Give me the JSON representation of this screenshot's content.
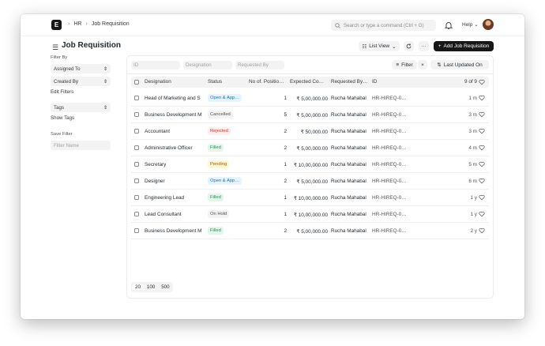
{
  "navbar": {
    "logo_letter": "E",
    "breadcrumbs": [
      "HR",
      "Job Requisition"
    ],
    "search_placeholder": "Search or type a command (Ctrl + G)",
    "help_label": "Help"
  },
  "page": {
    "title": "Job Requisition",
    "list_view_label": "List View",
    "more_label": "···",
    "add_label": "Add Job Requisition"
  },
  "sidebar": {
    "filter_by_label": "Filter By",
    "assigned_to": "Assigned To",
    "created_by": "Created By",
    "edit_filters": "Edit Filters",
    "tags": "Tags",
    "show_tags": "Show Tags",
    "save_filter_label": "Save Filter",
    "filter_name_placeholder": "Filter Name"
  },
  "filters": {
    "id_placeholder": "ID",
    "designation_placeholder": "Designation",
    "requested_by_placeholder": "Requested By",
    "filter_label": "Filter",
    "sort_label": "Last Updated On"
  },
  "table": {
    "columns": [
      "Designation",
      "Status",
      "No of. Positio…",
      "Expected Co…",
      "Requested By…",
      "ID"
    ],
    "count": "9 of 9",
    "rows": [
      {
        "designation": "Head of Marketing and S",
        "status": "Open & App…",
        "status_kind": "blue",
        "positions": "1",
        "compensation": "₹ 5,00,000.00",
        "requested_by": "Rucha Mahabal",
        "id": "HR-HIREQ-0…",
        "age": "1 m"
      },
      {
        "designation": "Business Development M",
        "status": "Cancelled",
        "status_kind": "gray",
        "positions": "5",
        "compensation": "₹ 5,00,000.00",
        "requested_by": "Rucha Mahabal",
        "id": "HR-HIREQ-0…",
        "age": "3 m"
      },
      {
        "designation": "Accountant",
        "status": "Rejected",
        "status_kind": "red",
        "positions": "2",
        "compensation": "₹ 50,000.00",
        "requested_by": "Rucha Mahabal",
        "id": "HR-HIREQ-0…",
        "age": "3 m"
      },
      {
        "designation": "Administrative Officer",
        "status": "Filled",
        "status_kind": "green",
        "positions": "2",
        "compensation": "₹ 5,00,000.00",
        "requested_by": "Rucha Mahabal",
        "id": "HR-HIREQ-0…",
        "age": "4 m"
      },
      {
        "designation": "Secretary",
        "status": "Pending",
        "status_kind": "yellow",
        "positions": "1",
        "compensation": "₹ 10,00,000.00",
        "requested_by": "Rucha Mahabal",
        "id": "HR-HIREQ-0…",
        "age": "5 m"
      },
      {
        "designation": "Designer",
        "status": "Open & App…",
        "status_kind": "blue",
        "positions": "2",
        "compensation": "₹ 5,00,000.00",
        "requested_by": "Rucha Mahabal",
        "id": "HR-HIREQ-0…",
        "age": "6 m"
      },
      {
        "designation": "Engineering Lead",
        "status": "Filled",
        "status_kind": "green",
        "positions": "1",
        "compensation": "₹ 10,00,000.00",
        "requested_by": "Rucha Mahabal",
        "id": "HR-HIREQ-0…",
        "age": "1 y"
      },
      {
        "designation": "Lead Consultant",
        "status": "On Hold",
        "status_kind": "gray",
        "positions": "1",
        "compensation": "₹ 10,00,000.00",
        "requested_by": "Rucha Mahabal",
        "id": "HR-HIREQ-0…",
        "age": "1 y"
      },
      {
        "designation": "Business Development M",
        "status": "Filled",
        "status_kind": "green",
        "positions": "2",
        "compensation": "₹ 5,00,000.00",
        "requested_by": "Rucha Mahabal",
        "id": "HR-HIREQ-0…",
        "age": "2 y"
      }
    ]
  },
  "paging": {
    "sizes": [
      "20",
      "100",
      "500"
    ]
  },
  "colors": {
    "blue": [
      "#e6f4ff",
      "#1d73c9"
    ],
    "gray": [
      "#f3f3f3",
      "#525252"
    ],
    "red": [
      "#fff0f0",
      "#d12c2c"
    ],
    "green": [
      "#e4f5e9",
      "#278f5e"
    ],
    "yellow": [
      "#fff7d3",
      "#a35b00"
    ]
  }
}
